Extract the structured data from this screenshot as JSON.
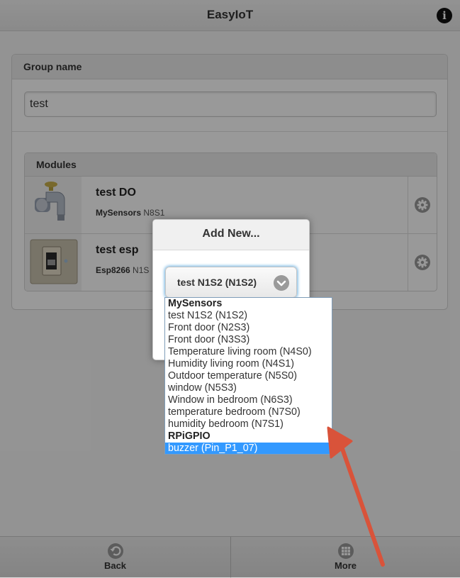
{
  "header": {
    "title": "EasyIoT",
    "info_glyph": "i"
  },
  "group": {
    "label": "Group name",
    "value": "test"
  },
  "modules": {
    "label": "Modules",
    "items": [
      {
        "title": "test DO",
        "source": "MySensors",
        "id": "N8S1",
        "icon": "water-tap-icon"
      },
      {
        "title": "test esp",
        "source": "Esp8266",
        "id": "N1S",
        "icon": "light-switch-icon"
      }
    ]
  },
  "popup": {
    "title": "Add New...",
    "selected": "test N1S2 (N1S2)",
    "options": [
      {
        "text": "MySensors",
        "group": true
      },
      {
        "text": "test N1S2 (N1S2)"
      },
      {
        "text": "Front door (N2S3)"
      },
      {
        "text": "Front door (N3S3)"
      },
      {
        "text": "Temperature living room (N4S0)"
      },
      {
        "text": "Humidity living room (N4S1)"
      },
      {
        "text": "Outdoor temperature (N5S0)"
      },
      {
        "text": "window (N5S3)"
      },
      {
        "text": "Window in bedroom (N6S3)"
      },
      {
        "text": "temperature bedroom (N7S0)"
      },
      {
        "text": "humidity bedroom (N7S1)"
      },
      {
        "text": "RPiGPIO",
        "group": true
      },
      {
        "text": "buzzer (Pin_P1_07)",
        "highlighted": true
      }
    ]
  },
  "footer": {
    "back_label": "Back",
    "more_label": "More"
  },
  "colors": {
    "highlight": "#3399ff",
    "annotation_arrow": "#d9533a",
    "focus_glow": "#6ab0e0"
  }
}
